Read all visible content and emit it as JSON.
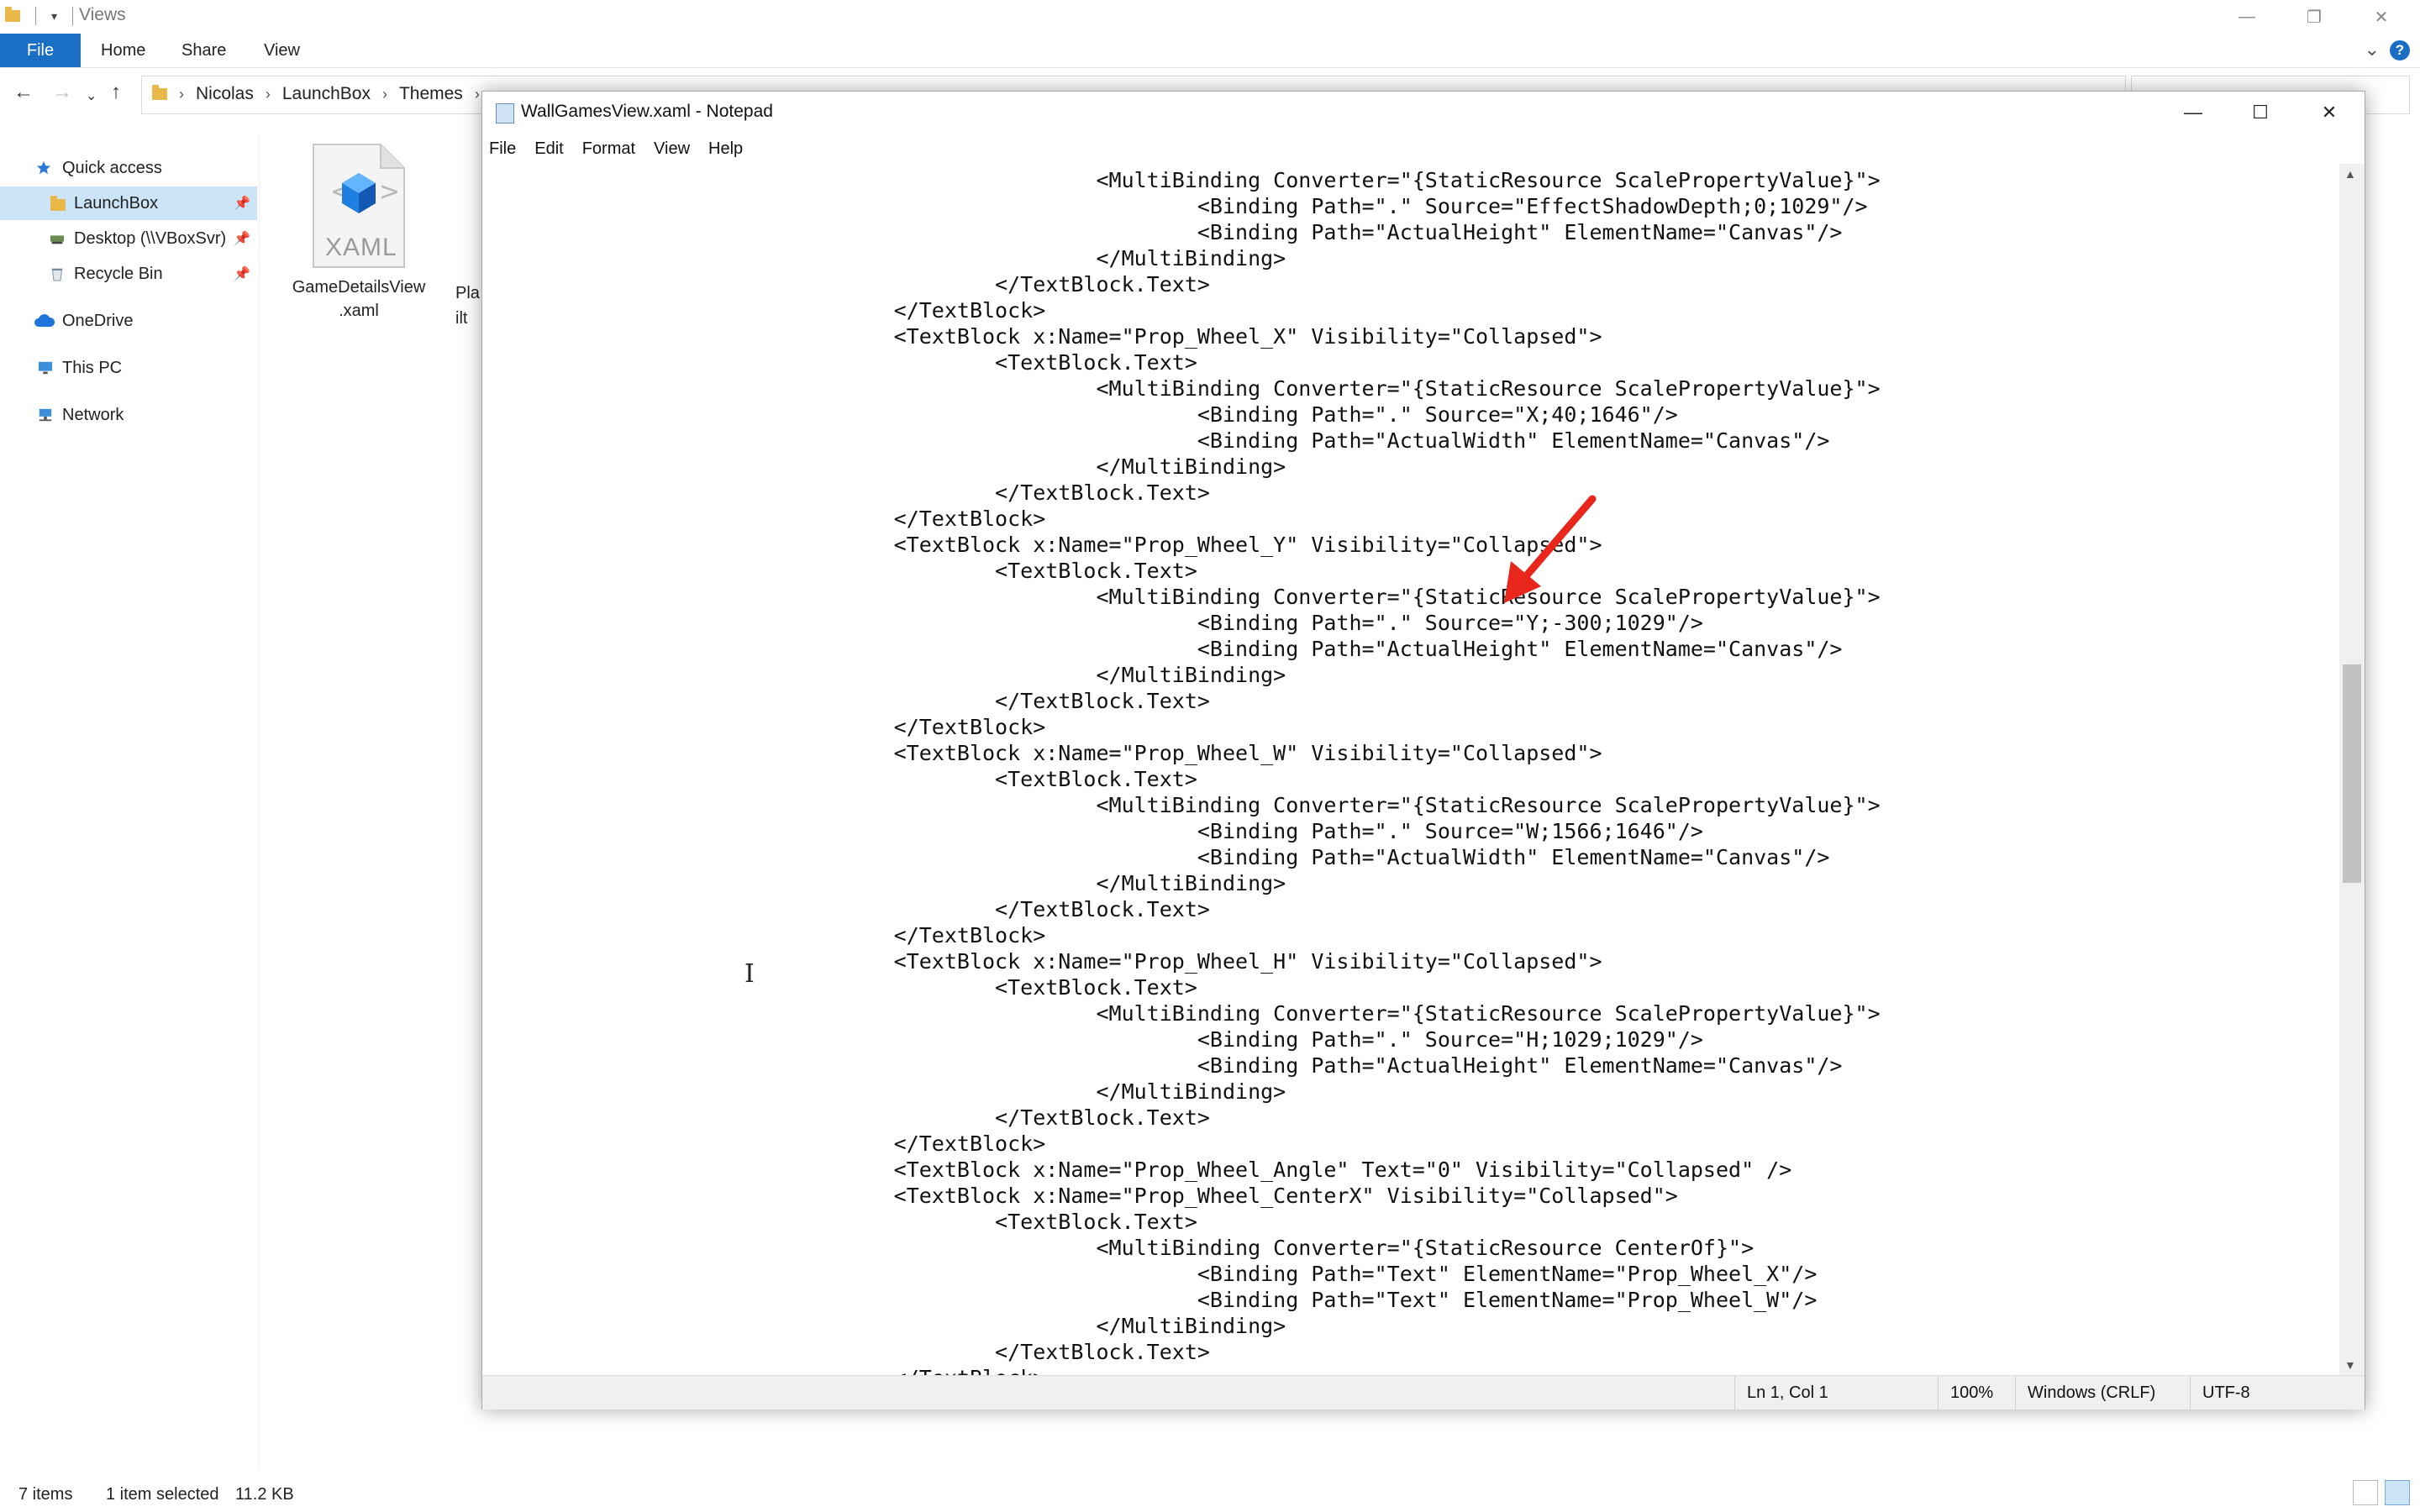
{
  "explorer": {
    "title": "Views",
    "window_controls": [
      "minimize",
      "restore",
      "close"
    ],
    "ribbon": {
      "file": "File",
      "tabs": [
        "Home",
        "Share",
        "View"
      ]
    },
    "breadcrumb": [
      "Nicolas",
      "LaunchBox",
      "Themes"
    ],
    "sidebar": {
      "quick_access": "Quick access",
      "items": [
        {
          "label": "LaunchBox",
          "icon": "folder-icon",
          "pinned": true,
          "selected": true
        },
        {
          "label": "Desktop (\\\\VBoxSvr)",
          "icon": "network-drive-icon",
          "pinned": true
        },
        {
          "label": "Recycle Bin",
          "icon": "recycle-bin-icon",
          "pinned": true
        }
      ],
      "onedrive": "OneDrive",
      "this_pc": "This PC",
      "network": "Network"
    },
    "files": [
      {
        "name_line1": "GameDetailsView",
        "name_line2": ".xaml",
        "icon_text": "XAML"
      }
    ],
    "partial_file": {
      "line1": "Pla",
      "line2": "ilt"
    },
    "status": {
      "items": "7 items",
      "selected": "1 item selected",
      "size": "11.2 KB"
    }
  },
  "notepad": {
    "title": "WallGamesView.xaml - Notepad",
    "menu": [
      "File",
      "Edit",
      "Format",
      "View",
      "Help"
    ],
    "content": "                                                <MultiBinding Converter=\"{StaticResource ScalePropertyValue}\">\n                                                        <Binding Path=\".\" Source=\"EffectShadowDepth;0;1029\"/>\n                                                        <Binding Path=\"ActualHeight\" ElementName=\"Canvas\"/>\n                                                </MultiBinding>\n                                        </TextBlock.Text>\n                                </TextBlock>\n                                <TextBlock x:Name=\"Prop_Wheel_X\" Visibility=\"Collapsed\">\n                                        <TextBlock.Text>\n                                                <MultiBinding Converter=\"{StaticResource ScalePropertyValue}\">\n                                                        <Binding Path=\".\" Source=\"X;40;1646\"/>\n                                                        <Binding Path=\"ActualWidth\" ElementName=\"Canvas\"/>\n                                                </MultiBinding>\n                                        </TextBlock.Text>\n                                </TextBlock>\n                                <TextBlock x:Name=\"Prop_Wheel_Y\" Visibility=\"Collapsed\">\n                                        <TextBlock.Text>\n                                                <MultiBinding Converter=\"{StaticResource ScalePropertyValue}\">\n                                                        <Binding Path=\".\" Source=\"Y;-300;1029\"/>\n                                                        <Binding Path=\"ActualHeight\" ElementName=\"Canvas\"/>\n                                                </MultiBinding>\n                                        </TextBlock.Text>\n                                </TextBlock>\n                                <TextBlock x:Name=\"Prop_Wheel_W\" Visibility=\"Collapsed\">\n                                        <TextBlock.Text>\n                                                <MultiBinding Converter=\"{StaticResource ScalePropertyValue}\">\n                                                        <Binding Path=\".\" Source=\"W;1566;1646\"/>\n                                                        <Binding Path=\"ActualWidth\" ElementName=\"Canvas\"/>\n                                                </MultiBinding>\n                                        </TextBlock.Text>\n                                </TextBlock>\n                                <TextBlock x:Name=\"Prop_Wheel_H\" Visibility=\"Collapsed\">\n                                        <TextBlock.Text>\n                                                <MultiBinding Converter=\"{StaticResource ScalePropertyValue}\">\n                                                        <Binding Path=\".\" Source=\"H;1029;1029\"/>\n                                                        <Binding Path=\"ActualHeight\" ElementName=\"Canvas\"/>\n                                                </MultiBinding>\n                                        </TextBlock.Text>\n                                </TextBlock>\n                                <TextBlock x:Name=\"Prop_Wheel_Angle\" Text=\"0\" Visibility=\"Collapsed\" />\n                                <TextBlock x:Name=\"Prop_Wheel_CenterX\" Visibility=\"Collapsed\">\n                                        <TextBlock.Text>\n                                                <MultiBinding Converter=\"{StaticResource CenterOf}\">\n                                                        <Binding Path=\"Text\" ElementName=\"Prop_Wheel_X\"/>\n                                                        <Binding Path=\"Text\" ElementName=\"Prop_Wheel_W\"/>\n                                                </MultiBinding>\n                                        </TextBlock.Text>\n                                </TextBlock>",
    "status": {
      "position": "Ln 1, Col 1",
      "zoom": "100%",
      "line_endings": "Windows (CRLF)",
      "encoding": "UTF-8"
    }
  },
  "annotation": {
    "type": "red-arrow",
    "color": "#e8261c"
  }
}
